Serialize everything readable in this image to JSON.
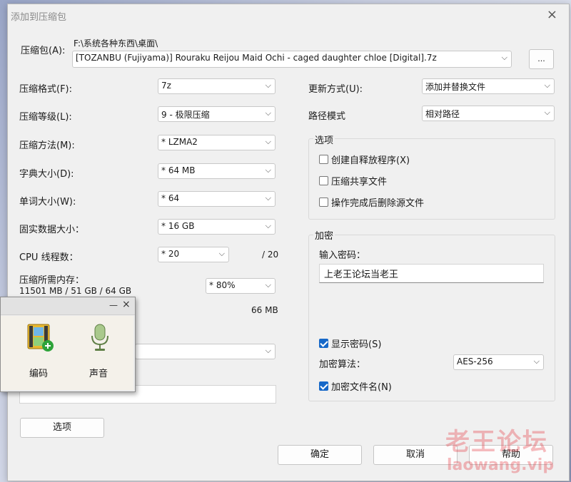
{
  "window": {
    "title": "添加到压缩包",
    "close": "×"
  },
  "archive": {
    "label": "压缩包(A):",
    "path": "F:\\系统各种东西\\桌面\\",
    "filename": "[TOZANBU (Fujiyama)] Rouraku Reijou Maid Ochi - caged daughter chloe [Digital].7z",
    "browse_label": "..."
  },
  "left": {
    "format": {
      "label": "压缩格式(F):",
      "value": "7z"
    },
    "level": {
      "label": "压缩等级(L):",
      "value": "9 - 极限压缩"
    },
    "method": {
      "label": "压缩方法(M):",
      "value": "* LZMA2"
    },
    "dict": {
      "label": "字典大小(D):",
      "value": "* 64 MB"
    },
    "word": {
      "label": "单词大小(W):",
      "value": "* 64"
    },
    "solid": {
      "label": "固实数据大小：",
      "value": "* 16 GB"
    },
    "threads": {
      "label": "CPU 线程数：",
      "value": "* 20",
      "max": "/ 20"
    },
    "memory": {
      "label": "压缩所需内存：",
      "detail": "11501 MB / 51 GB / 64 GB",
      "value": "* 80%"
    },
    "decompress_mem": "66 MB"
  },
  "right": {
    "update": {
      "label": "更新方式(U):",
      "value": "添加并替换文件"
    },
    "pathmode": {
      "label": "路径模式",
      "value": "相对路径"
    },
    "options": {
      "title": "选项",
      "sfx": "创建自释放程序(X)",
      "shared": "压缩共享文件",
      "delete": "操作完成后删除源文件"
    },
    "encryption": {
      "title": "加密",
      "pw_label": "输入密码：",
      "pw_value": "上老王论坛当老王",
      "show_pw": "显示密码(S)",
      "method_label": "加密算法：",
      "method_value": "AES-256",
      "encrypt_names": "加密文件名(N)"
    }
  },
  "buttons": {
    "options": "选项",
    "ok": "确定",
    "cancel": "取消",
    "help": "帮助"
  },
  "overlay": {
    "item1": "编码",
    "item2": "声音",
    "minimize": "—",
    "close": "×"
  },
  "watermark": {
    "line1": "老王论坛",
    "line2": "laowang.vip"
  },
  "icons": [
    "close-icon",
    "chevron-down-icon",
    "film-add-icon",
    "microphone-icon",
    "checkbox-checked-icon"
  ]
}
